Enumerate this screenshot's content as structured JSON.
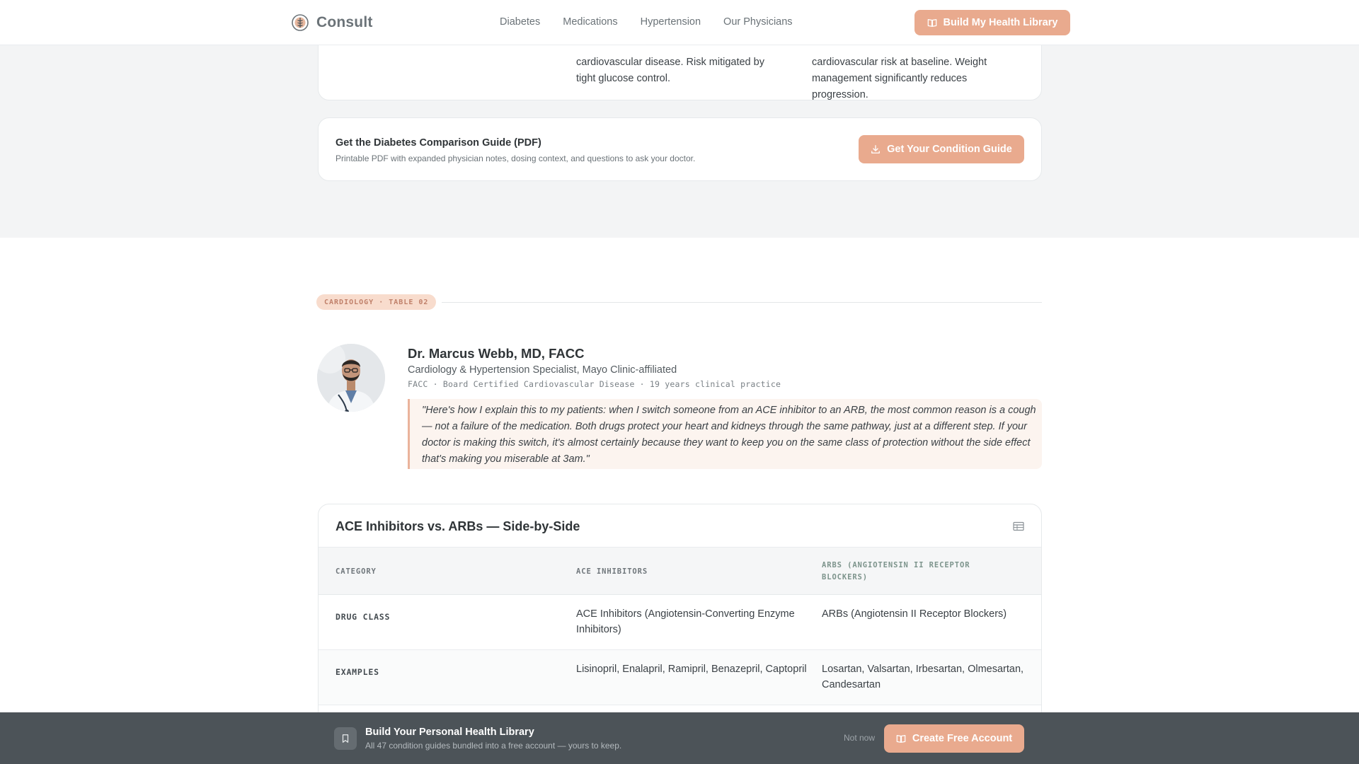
{
  "nav": {
    "brand": "Consult",
    "links": [
      "Diabetes",
      "Medications",
      "Hypertension",
      "Our Physicians"
    ],
    "cta_label": "Build My Health Library"
  },
  "prev_table_tail": {
    "col2_text": "cardiovascular disease. Risk mitigated by tight glucose control.",
    "col3_text": "cardiovascular risk at baseline. Weight management significantly reduces progression."
  },
  "guide": {
    "title": "Get the Diabetes Comparison Guide (PDF)",
    "subtitle": "Printable PDF with expanded physician notes, dosing context, and questions to ask your doctor.",
    "button_label": "Get Your Condition Guide"
  },
  "section": {
    "tag": "CARDIOLOGY · TABLE 02"
  },
  "physician": {
    "name": "Dr. Marcus Webb, MD, FACC",
    "title": "Cardiology & Hypertension Specialist, Mayo Clinic-affiliated",
    "credentials": "FACC · Board Certified Cardiovascular Disease · 19 years clinical practice",
    "quote": "\"Here's how I explain this to my patients: when I switch someone from an ACE inhibitor to an ARB, the most common reason is a cough — not a failure of the medication. Both drugs protect your heart and kidneys through the same pathway, just at a different step. If your doctor is making this switch, it's almost certainly because they want to keep you on the same class of protection without the side effect that's making you miserable at 3am.\""
  },
  "comparison": {
    "title": "ACE Inhibitors vs. ARBs — Side-by-Side",
    "headers": [
      "CATEGORY",
      "ACE INHIBITORS",
      "ARBS (ANGIOTENSIN II RECEPTOR BLOCKERS)"
    ],
    "rows": [
      {
        "category": "DRUG CLASS",
        "ace": "ACE Inhibitors (Angiotensin-Converting Enzyme Inhibitors)",
        "arb": "ARBs (Angiotensin II Receptor Blockers)"
      },
      {
        "category": "EXAMPLES",
        "ace": "Lisinopril, Enalapril, Ramipril, Benazepril, Captopril",
        "arb": "Losartan, Valsartan, Irbesartan, Olmesartan, Candesartan"
      }
    ]
  },
  "banner": {
    "title": "Build Your Personal Health Library",
    "subtitle": "All 47 condition guides bundled into a free account — yours to keep.",
    "dismiss_label": "Not now",
    "cta_label": "Create Free Account"
  },
  "icons": {
    "logo": "caduceus-logo-icon",
    "library": "open-book-icon",
    "download": "download-icon",
    "table": "table-icon",
    "bookmark": "bookmark-icon"
  },
  "colors": {
    "accent": "#e9aa8e",
    "tag_bg": "#f8dccd",
    "quote_bg": "#fcf4ef",
    "banner_bg": "#4c5358"
  }
}
